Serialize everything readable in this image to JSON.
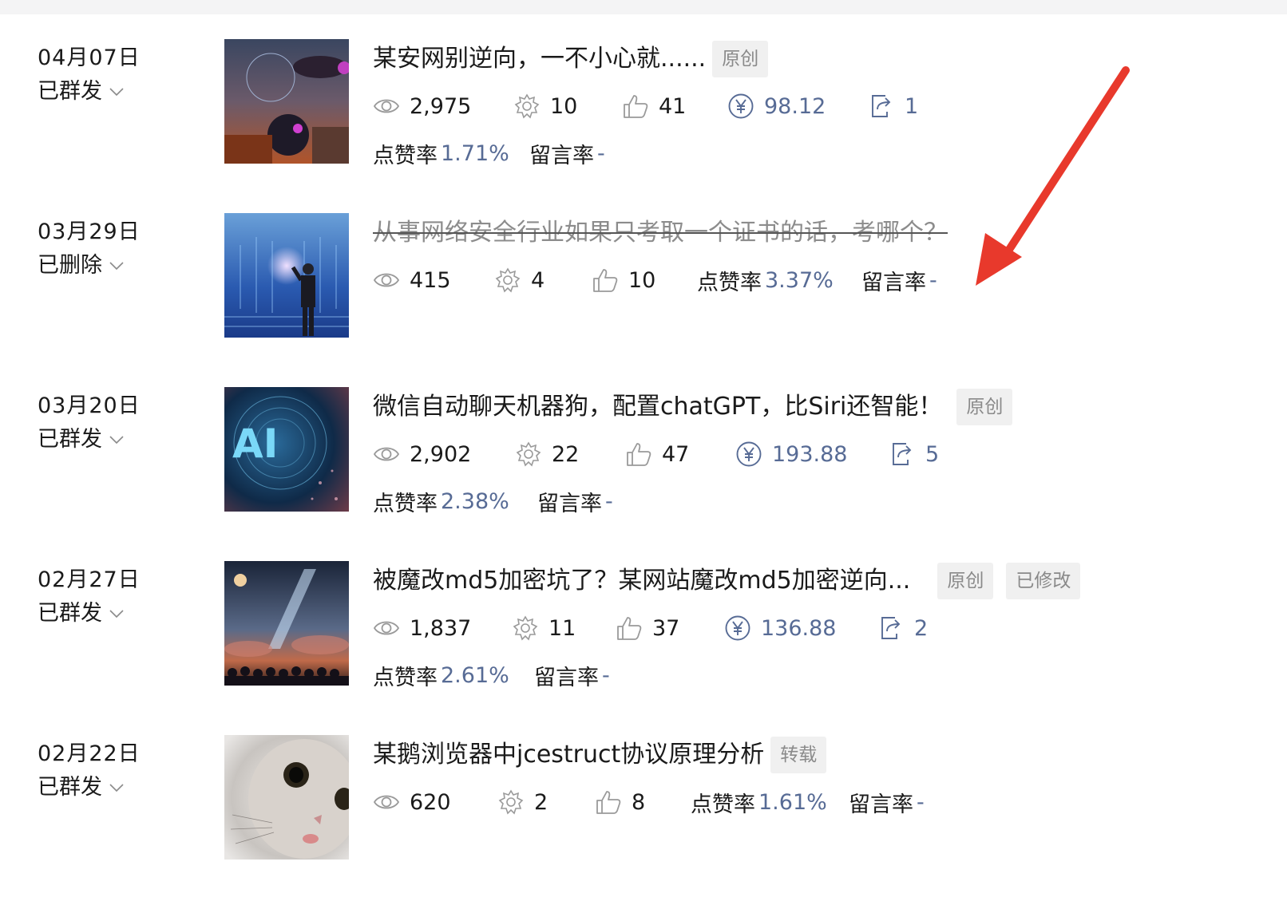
{
  "colors": {
    "link_blue": "#576b95",
    "tag_bg": "#f0f0f0",
    "arrow_red": "#e8392c"
  },
  "labels": {
    "like_rate": "点赞率",
    "comment_rate": "留言率",
    "comment_rate_value": "-"
  },
  "articles": [
    {
      "date": "04月07日",
      "status": "已群发",
      "title": "某安网别逆向，一不小心就......",
      "deleted": false,
      "tags": [
        "原创"
      ],
      "views": "2,975",
      "shares": "10",
      "likes": "41",
      "reward": "98.12",
      "forwards": "1",
      "like_rate": "1.71%",
      "comment_rate": "-",
      "thumbnail": "sci-fi-airship-image"
    },
    {
      "date": "03月29日",
      "status": "已删除",
      "title": "从事网络安全行业如果只考取一个证书的话，考哪个？",
      "deleted": true,
      "tags": [],
      "views": "415",
      "shares": "4",
      "likes": "10",
      "like_rate": "3.37%",
      "comment_rate": "-",
      "thumbnail": "businessman-digital-grid-image"
    },
    {
      "date": "03月20日",
      "status": "已群发",
      "title": "微信自动聊天机器狗，配置chatGPT，比Siri还智能！",
      "deleted": false,
      "tags": [
        "原创"
      ],
      "views": "2,902",
      "shares": "22",
      "likes": "47",
      "reward": "193.88",
      "forwards": "5",
      "like_rate": "2.38%",
      "comment_rate": "-",
      "thumbnail": "ai-circuit-image"
    },
    {
      "date": "02月27日",
      "status": "已群发",
      "title": "被魔改md5加密坑了？某网站魔改md5加密逆向...",
      "deleted": false,
      "tags": [
        "原创",
        "已修改"
      ],
      "views": "1,837",
      "shares": "11",
      "likes": "37",
      "reward": "136.88",
      "forwards": "2",
      "like_rate": "2.61%",
      "comment_rate": "-",
      "thumbnail": "night-sky-crowd-image"
    },
    {
      "date": "02月22日",
      "status": "已群发",
      "title": "某鹅浏览器中jcestruct协议原理分析",
      "deleted": false,
      "tags": [
        "转载"
      ],
      "views": "620",
      "shares": "2",
      "likes": "8",
      "like_rate": "1.61%",
      "comment_rate": "-",
      "thumbnail": "kitten-image"
    }
  ]
}
